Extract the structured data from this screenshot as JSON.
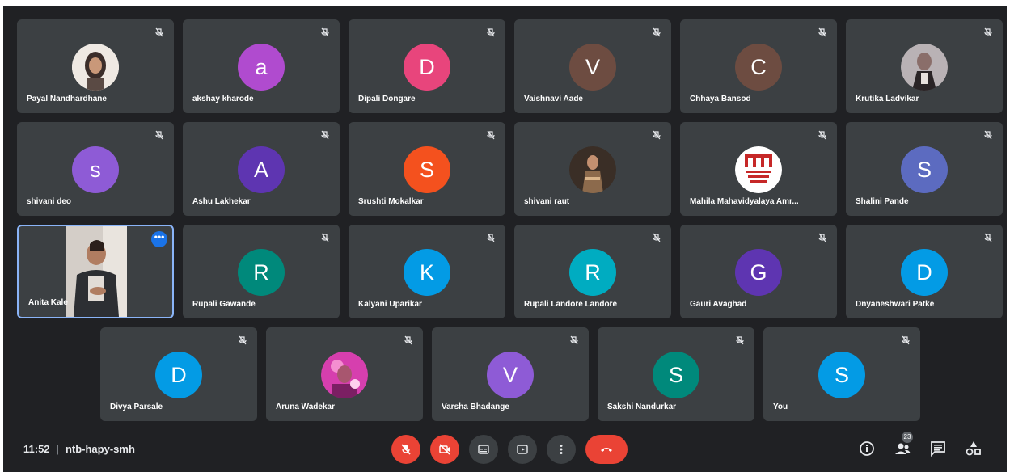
{
  "meeting": {
    "time": "11:52",
    "separator": "|",
    "code": "ntb-hapy-smh",
    "participant_count": "23"
  },
  "colors": {
    "background": "#202124",
    "tile": "#3c4043",
    "active_border": "#8ab4f8",
    "end_call": "#ea4335"
  },
  "participants": [
    {
      "name": "Payal Nandhardhane",
      "avatar": "photo",
      "muted": true
    },
    {
      "name": "akshay kharode",
      "initial": "a",
      "color": "#b04bcf",
      "muted": true
    },
    {
      "name": "Dipali Dongare",
      "initial": "D",
      "color": "#e8457c",
      "muted": true
    },
    {
      "name": "Vaishnavi Aade",
      "initial": "V",
      "color": "#6d4c41",
      "muted": true
    },
    {
      "name": "Chhaya Bansod",
      "initial": "C",
      "color": "#6d4c41",
      "muted": true
    },
    {
      "name": "Krutika Ladvikar",
      "avatar": "photo",
      "muted": true
    },
    {
      "name": "shivani deo",
      "initial": "s",
      "color": "#8e5bd6",
      "muted": true
    },
    {
      "name": "Ashu Lakhekar",
      "initial": "A",
      "color": "#5e35b1",
      "muted": true
    },
    {
      "name": "Srushti Mokalkar",
      "initial": "S",
      "color": "#f4511e",
      "muted": true
    },
    {
      "name": "shivani raut",
      "avatar": "photo",
      "muted": true
    },
    {
      "name": "Mahila Mahavidyalaya Amr...",
      "avatar": "photo",
      "muted": true
    },
    {
      "name": "Shalini Pande",
      "initial": "S",
      "color": "#5c6bc0",
      "muted": true
    },
    {
      "name": "Anita Kale",
      "avatar": "video",
      "muted": false
    },
    {
      "name": "Rupali Gawande",
      "initial": "R",
      "color": "#00897b",
      "muted": true
    },
    {
      "name": "Kalyani Uparikar",
      "initial": "K",
      "color": "#039be5",
      "muted": true
    },
    {
      "name": "Rupali Landore Landore",
      "initial": "R",
      "color": "#00acc1",
      "muted": true
    },
    {
      "name": "Gauri Avaghad",
      "initial": "G",
      "color": "#5e35b1",
      "muted": true
    },
    {
      "name": "Dnyaneshwari Patke",
      "initial": "D",
      "color": "#039be5",
      "muted": true
    },
    {
      "name": "Divya Parsale",
      "initial": "D",
      "color": "#039be5",
      "muted": true
    },
    {
      "name": "Aruna Wadekar",
      "avatar": "photo",
      "muted": true
    },
    {
      "name": "Varsha Bhadange",
      "initial": "V",
      "color": "#8e5bd6",
      "muted": true
    },
    {
      "name": "Sakshi Nandurkar",
      "initial": "S",
      "color": "#00897b",
      "muted": true
    },
    {
      "name": "You",
      "initial": "S",
      "color": "#039be5",
      "muted": true
    }
  ],
  "controls": {
    "mic": "mic-off-icon",
    "camera": "camera-off-icon",
    "captions": "captions-icon",
    "present": "present-icon",
    "more": "more-vert-icon",
    "end": "end-call-icon"
  }
}
